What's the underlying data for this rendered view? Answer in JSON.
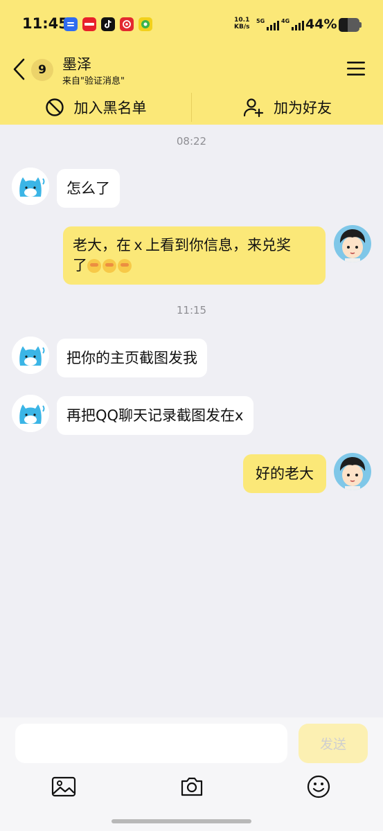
{
  "status_bar": {
    "time": "11:45",
    "net_speed_value": "10.1",
    "net_speed_unit": "KB/s",
    "sim1_label": "5G",
    "sim2_label": "4G",
    "battery_percent_text": "44%",
    "battery_level": 0.44,
    "app_icons": [
      "notification-icon",
      "store-icon",
      "tiktok-icon",
      "netease-music-icon",
      "game-icon"
    ]
  },
  "header": {
    "unread_count": "9",
    "contact_name": "墨泽",
    "contact_source": "来自\"验证消息\"",
    "block_label": "加入黑名单",
    "add_friend_label": "加为好友"
  },
  "messages": [
    {
      "type": "timestamp",
      "text": "08:22"
    },
    {
      "type": "incoming",
      "text": "怎么了"
    },
    {
      "type": "outgoing",
      "text_line1": "老大，在ｘ上看到你信息，来兑奖",
      "text_line2": "了",
      "emojis": [
        "dizzy-face-emoji",
        "dizzy-face-emoji",
        "dizzy-face-emoji"
      ]
    },
    {
      "type": "timestamp",
      "text": "11:15"
    },
    {
      "type": "incoming",
      "text": "把你的主页截图发我"
    },
    {
      "type": "incoming",
      "text": "再把QQ聊天记录截图发在x"
    },
    {
      "type": "outgoing",
      "text": "好的老大"
    }
  ],
  "input_bar": {
    "placeholder": "",
    "send_label": "发送",
    "tools": [
      "image-icon",
      "camera-icon",
      "emoji-icon"
    ]
  },
  "colors": {
    "accent_yellow": "#fbe878",
    "send_disabled": "#fcf0b2",
    "chat_bg": "#efeff4"
  }
}
